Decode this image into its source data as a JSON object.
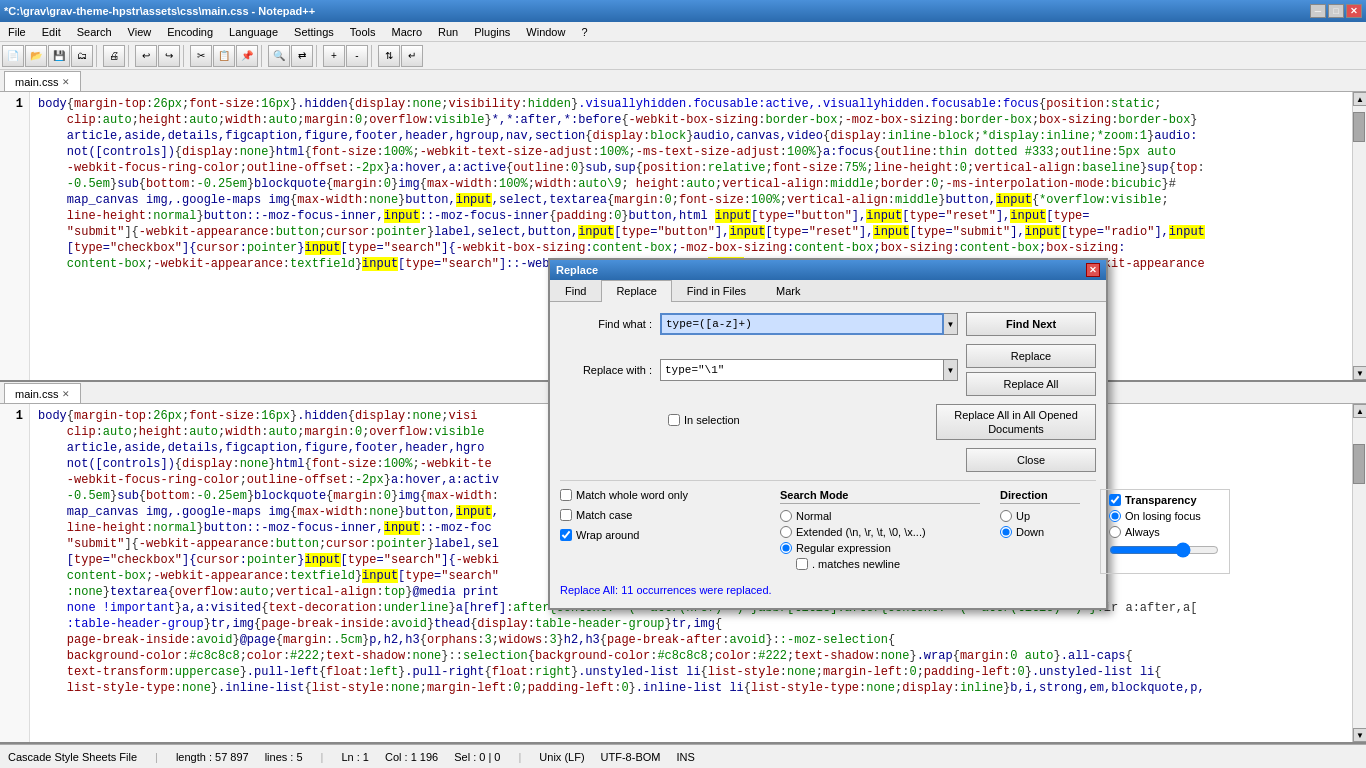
{
  "titlebar": {
    "title": "*C:\\grav\\grav-theme-hpstr\\assets\\css\\main.css - Notepad++",
    "min": "─",
    "max": "□",
    "close": "✕"
  },
  "menubar": {
    "items": [
      "File",
      "Edit",
      "Search",
      "View",
      "Encoding",
      "Language",
      "Settings",
      "Tools",
      "Macro",
      "Run",
      "Plugins",
      "Window",
      "?"
    ]
  },
  "tabs": [
    {
      "label": "main.css",
      "active": true
    },
    {
      "label": "main.css",
      "active": false
    }
  ],
  "editor1": {
    "linenum": "1",
    "lines": [
      "body{margin-top:26px;font-size:16px}.hidden{display:none;visibility:hidden}.visuallyhidden.focusable:active,.visuallyhidden.focusable:focus{position:static;",
      "    clip:auto;height:auto;width:auto;margin:0;overflow:visible}*,*:after,*:before{-webkit-box-sizing:border-box;-moz-box-sizing:border-box;box-sizing:border-box}",
      "    article,aside,details,figcaption,figure,footer,header,hgroup,nav,section{display:block}audio,canvas,video{display:inline-block;*display:inline;*zoom:1}audio:",
      "    not([controls]){display:none}html{font-size:100%;-webkit-text-size-adjust:100%;-ms-text-size-adjust:100%}a:focus{outline:thin dotted #333;outline:5px auto",
      "    -webkit-focus-ring-color;outline-offset:-2px}a:hover,a:active{outline:0}sub,sup{position:relative;font-size:75%;line-height:0;vertical-align:baseline}sup{top:",
      "    -0.5em}sub{bottom:-0.25em}blockquote{margin:0}img{max-width:100%;width:auto\\9; height:auto;vertical-align:middle;border:0;-ms-interpolation-mode:bicubic}#",
      "    map_canvas img,.google-maps img{max-width:none}button,input,select,textarea{margin:0;font-size:100%;vertical-align:middle}button,input{*overflow:visible;",
      "    line-height:normal}button::-moz-focus-inner,input::-moz-focus-inner{padding:0}button,html input[type=\"button\"],input[type=\"reset\"],input[type=",
      "    \"submit\"]{-webkit-appearance:button;cursor:pointer}label,select,button,input[type=\"button\"],input[type=\"reset\"],input[type=\"submit\"],input[type=\"radio\"],input",
      "    [type=\"checkbox\"]{cursor:pointer}input[type=\"search\"]{-webkit-box-sizing:content-box;-moz-box-sizing:content-box;box-sizing:content-box;box-sizing:",
      "    content-box;-webkit-appearance:textfield}input[type=\"search\"]::-webkit-search-decoration,input[type=\"search\"]::-webkit-search-cancel-button{-webkit-appearance"
    ]
  },
  "editor2": {
    "linenum": "1",
    "lines": [
      "body{margin-top:26px;font-size:16px}.hidden{display:none;visi",
      "    clip:auto;height:auto;width:auto;margin:0;overflow:visible",
      "    article,aside,details,figcaption,figure,footer,header,hgro",
      "    not([controls]){display:none}html{font-size:100%;-webkit-te",
      "    -webkit-focus-ring-color;outline-offset:-2px}a:hover,a:activ",
      "    -0.5em}sub{bottom:-0.25em}blockquote{margin:0}img{max-width:",
      "    map_canvas img,.google-maps img{max-width:none}button,input,",
      "    line-height:normal}button::-moz-focus-inner,input::-moz-foc",
      "    \"submit\"]{-webkit-appearance:button;cursor:pointer}label,sel",
      "    [type=\"checkbox\"]{cursor:pointer}input[type=\"search\"]{-webki",
      "    content-box;-webkit-appearance:textfield}input[type=\"search\"",
      "    :none}textarea{overflow:auto;vertical-align:top}@media print"
    ]
  },
  "dialog": {
    "title": "Replace",
    "tabs": [
      "Find",
      "Replace",
      "Find in Files",
      "Mark"
    ],
    "active_tab": "Replace",
    "find_label": "Find what :",
    "find_value": "type=([a-z]+)",
    "replace_label": "Replace with :",
    "replace_value": "type=\"\\1\"",
    "in_selection_label": "In selection",
    "buttons": {
      "find_next": "Find Next",
      "replace": "Replace",
      "replace_all": "Replace All",
      "replace_all_opened": "Replace All in All Opened\nDocuments",
      "close": "Close"
    },
    "checkboxes": {
      "match_whole_word": "Match whole word only",
      "match_case": "Match case",
      "wrap_around": "Wrap around"
    },
    "search_mode": {
      "title": "Search Mode",
      "options": [
        "Normal",
        "Extended (\\n, \\r, \\t, \\0, \\x...)",
        "Regular expression"
      ],
      "selected": "Regular expression",
      "matches_newline": ". matches newline"
    },
    "direction": {
      "title": "Direction",
      "options": [
        "Up",
        "Down"
      ],
      "selected": "Down"
    },
    "transparency": {
      "title": "Transparency",
      "checked": true,
      "options": [
        "On losing focus",
        "Always"
      ],
      "selected": "On losing focus",
      "slider_value": 70
    },
    "status_message": "Replace All: 11 occurrences were replaced."
  },
  "statusbar": {
    "file": "Cascade Style Sheets File",
    "length": "length : 57 897",
    "lines": "lines : 5",
    "ln": "Ln : 1",
    "col": "Col : 1 196",
    "sel": "Sel : 0 | 0",
    "eol": "Unix (LF)",
    "encoding": "UTF-8-BOM",
    "ins": "INS"
  }
}
